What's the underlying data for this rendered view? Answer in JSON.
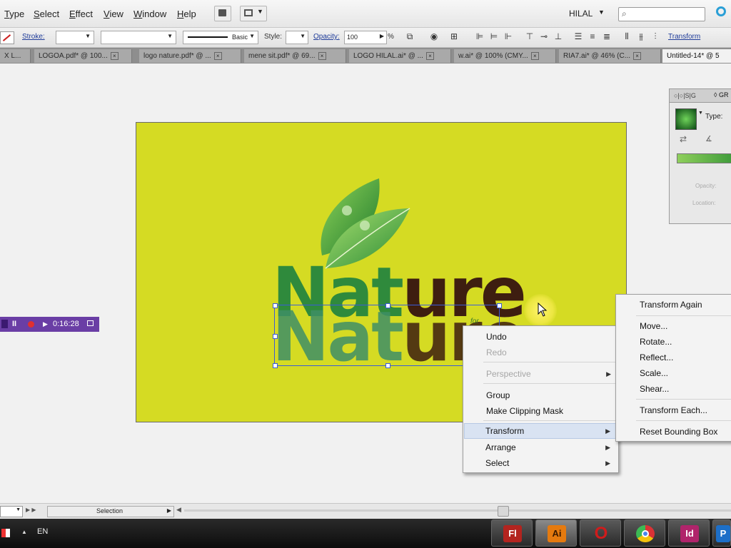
{
  "menubar": {
    "items": [
      "Type",
      "Select",
      "Effect",
      "View",
      "Window",
      "Help"
    ],
    "workspace": "HILAL",
    "search_placeholder": ""
  },
  "controlbar": {
    "stroke_label": "Stroke:",
    "brush_label": "Basic",
    "style_label": "Style:",
    "opacity_label": "Opacity:",
    "opacity_value": "100",
    "opacity_unit": "%",
    "transform_label": "Transform"
  },
  "tabs": [
    "X L...",
    "LOGOA.pdf* @ 100...",
    "logo nature.pdf* @ ...",
    "mene sit.pdf* @ 69...",
    "LOGO HILAL.ai* @ ...",
    "w.ai* @ 100% (CMY...",
    "RIA7.ai* @ 46% (C...",
    "Untitled-14* @ 5"
  ],
  "artwork": {
    "word_part1": "Nat",
    "word_part2": "ure",
    "tagline": "for"
  },
  "recorder": {
    "pause_label": "II",
    "time": "0:16:28"
  },
  "context_menu": {
    "items": [
      {
        "label": "Undo",
        "disabled": false,
        "submenu": false
      },
      {
        "label": "Redo",
        "disabled": true,
        "submenu": false
      },
      {
        "label": "Perspective",
        "disabled": true,
        "submenu": true
      },
      {
        "label": "Group",
        "disabled": false,
        "submenu": false
      },
      {
        "label": "Make Clipping Mask",
        "disabled": false,
        "submenu": false
      },
      {
        "label": "Transform",
        "disabled": false,
        "submenu": true
      },
      {
        "label": "Arrange",
        "disabled": false,
        "submenu": true
      },
      {
        "label": "Select",
        "disabled": false,
        "submenu": true
      }
    ]
  },
  "transform_submenu": {
    "items": [
      "Transform Again",
      "Move...",
      "Rotate...",
      "Reflect...",
      "Scale...",
      "Shear...",
      "Transform Each...",
      "Reset Bounding Box"
    ]
  },
  "gradient_panel": {
    "tab_label": "GR",
    "type_label": "Type:",
    "opacity_label": "Opacity:",
    "location_label": "Location:"
  },
  "statusbar": {
    "tool": "Selection"
  },
  "taskbar": {
    "language": "EN",
    "apps": [
      {
        "name": "Flash",
        "label": "Fl",
        "color": "#b3241f"
      },
      {
        "name": "Illustrator",
        "label": "Ai",
        "color": "#e57a0f"
      },
      {
        "name": "Opera",
        "label": "O",
        "color": "#d01c1c"
      },
      {
        "name": "Chrome",
        "label": "",
        "color": "#2f8f3a"
      },
      {
        "name": "InDesign",
        "label": "Id",
        "color": "#b0246b"
      },
      {
        "name": "Photoshop",
        "label": "P",
        "color": "#1d6fc8"
      }
    ]
  }
}
